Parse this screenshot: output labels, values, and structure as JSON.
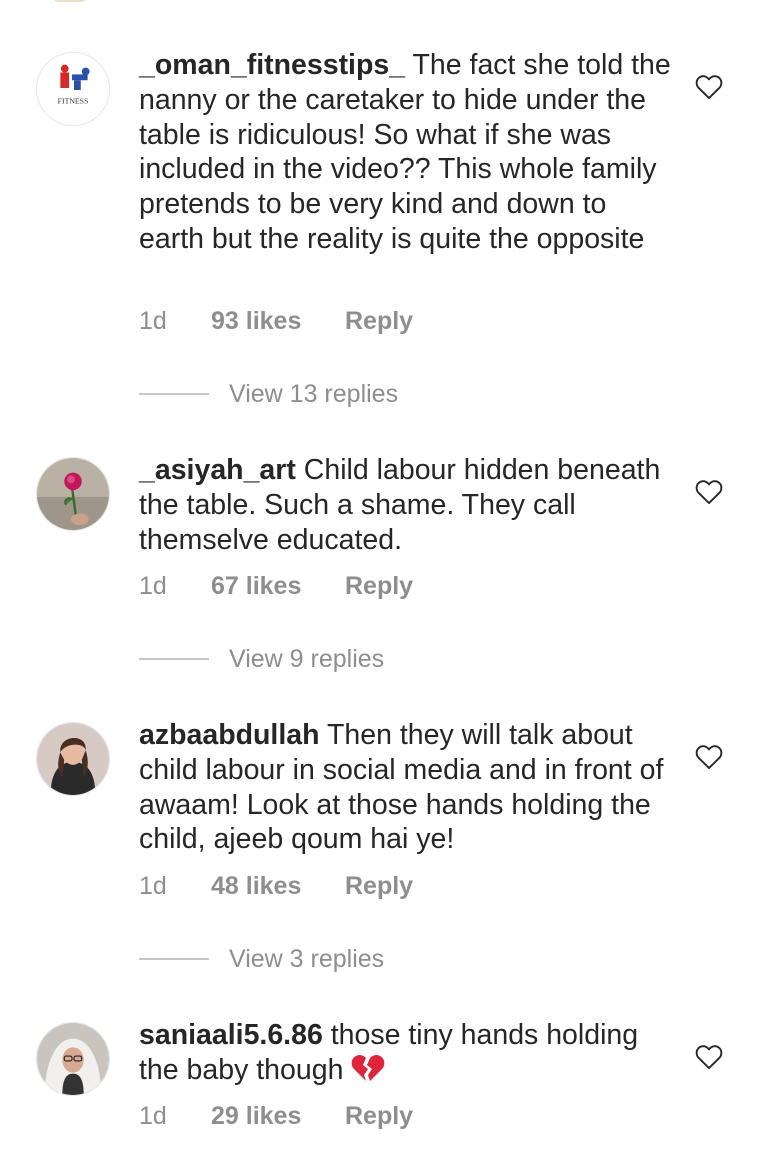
{
  "comments": [
    {
      "username": "_oman_fitnesstips_",
      "text": "The fact she told the nanny or the caretaker to hide under the table is ridiculous! So what if she was included in the video?? This whole family pretends to be very kind and down to earth but the reality is quite the opposite",
      "time": "1d",
      "likes": "93 likes",
      "reply": "Reply",
      "view_replies": "View 13 replies",
      "avatar_text": "FITNESS"
    },
    {
      "username": "_asiyah_art",
      "text": "Child labour hidden beneath the table. Such a shame. They call themselve educated.",
      "time": "1d",
      "likes": "67 likes",
      "reply": "Reply",
      "view_replies": "View 9 replies"
    },
    {
      "username": "azbaabdullah",
      "text": "Then they will talk about child labour in social media and in front of awaam! Look at those hands holding the child, ajeeb qoum hai ye!",
      "time": "1d",
      "likes": "48 likes",
      "reply": "Reply",
      "view_replies": "View 3 replies"
    },
    {
      "username": "saniaali5.6.86",
      "text": "those tiny hands holding the baby though",
      "emoji": "broken-heart-icon",
      "time": "1d",
      "likes": "29 likes",
      "reply": "Reply"
    }
  ],
  "colors": {
    "text": "#262626",
    "secondary": "#8e8e8e",
    "emoji_red": "#e0243c"
  }
}
